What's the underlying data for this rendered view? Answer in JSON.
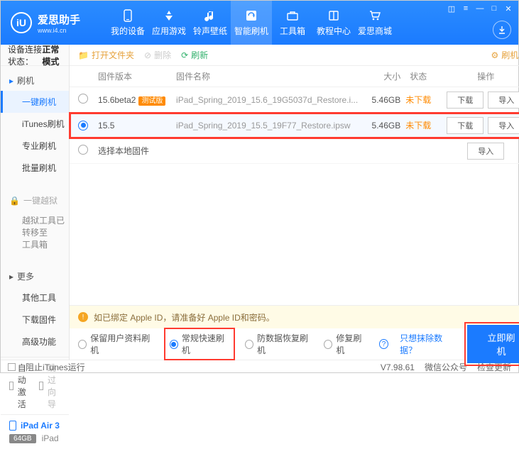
{
  "brand": {
    "name": "爱思助手",
    "url": "www.i4.cn",
    "logo": "iU"
  },
  "nav": {
    "items": [
      {
        "label": "我的设备"
      },
      {
        "label": "应用游戏"
      },
      {
        "label": "铃声壁纸"
      },
      {
        "label": "智能刷机"
      },
      {
        "label": "工具箱"
      },
      {
        "label": "教程中心"
      },
      {
        "label": "爱思商城"
      }
    ],
    "active": 3
  },
  "status": {
    "label": "设备连接状态：",
    "value": "正常模式"
  },
  "sidebar": {
    "sec1": {
      "title": "刷机",
      "items": [
        "一键刷机",
        "iTunes刷机",
        "专业刷机",
        "批量刷机"
      ],
      "selected": 0
    },
    "sec2": {
      "title": "一键越狱",
      "note": "越狱工具已转移至\n工具箱"
    },
    "sec3": {
      "title": "更多",
      "items": [
        "其他工具",
        "下载固件",
        "高级功能"
      ]
    },
    "auto_act": "自动激活",
    "skip_guide": "跳过向导"
  },
  "device": {
    "name": "iPad Air 3",
    "storage": "64GB",
    "type": "iPad"
  },
  "toolbar": {
    "open": "打开文件夹",
    "delete": "删除",
    "refresh": "刷新",
    "settings": "刷机设置"
  },
  "table": {
    "cols": {
      "ver": "固件版本",
      "name": "固件名称",
      "size": "大小",
      "status": "状态",
      "ops": "操作"
    },
    "rows": [
      {
        "ver": "15.6beta2",
        "tag": "测试版",
        "name": "iPad_Spring_2019_15.6_19G5037d_Restore.i...",
        "size": "5.46GB",
        "status": "未下载",
        "sel": false
      },
      {
        "ver": "15.5",
        "tag": "",
        "name": "iPad_Spring_2019_15.5_19F77_Restore.ipsw",
        "size": "5.46GB",
        "status": "未下载",
        "sel": true
      }
    ],
    "local": "选择本地固件",
    "btn_dl": "下载",
    "btn_imp": "导入"
  },
  "warn": "如已绑定 Apple ID，请准备好 Apple ID和密码。",
  "opts": {
    "o1": "保留用户资料刷机",
    "o2": "常规快速刷机",
    "o3": "防数据恢复刷机",
    "o4": "修复刷机",
    "link": "只想抹除数据？",
    "primary": "立即刷机",
    "selected": 1
  },
  "footer": {
    "block": "阻止iTunes运行",
    "ver": "V7.98.61",
    "wx": "微信公众号",
    "chk": "检查更新"
  }
}
